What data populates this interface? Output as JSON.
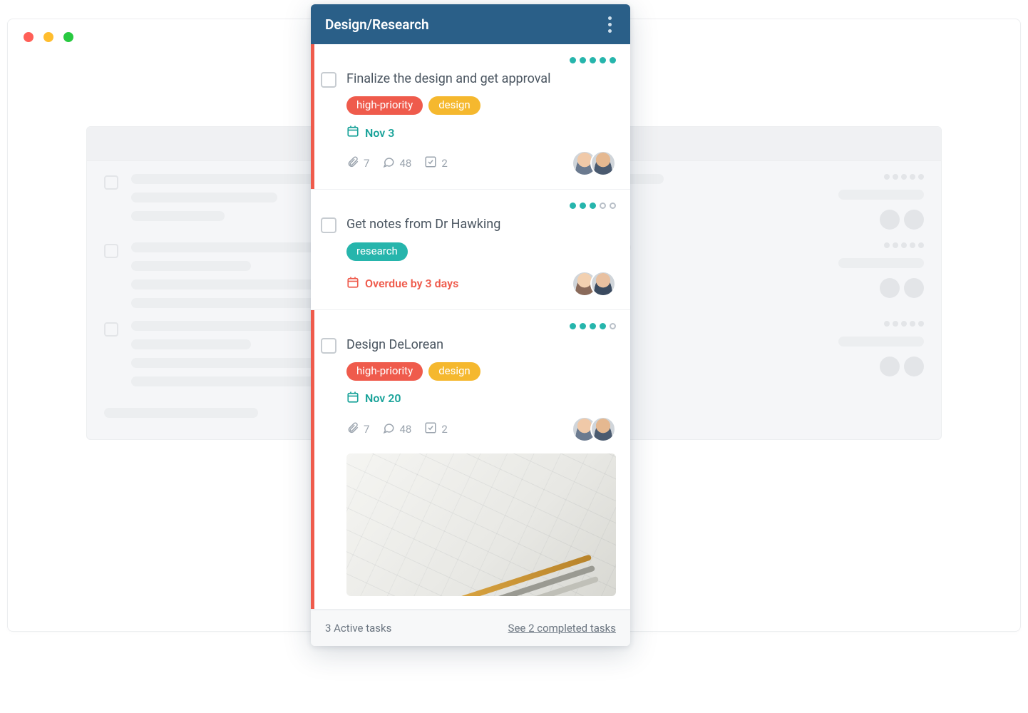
{
  "panel": {
    "title": "Design/Research"
  },
  "tasks": [
    {
      "title": "Finalize the design and get approval",
      "priority_stripe": true,
      "progress_filled": 5,
      "progress_total": 5,
      "tags": [
        {
          "label": "high-priority",
          "color": "red"
        },
        {
          "label": "design",
          "color": "yellow"
        }
      ],
      "date": {
        "label": "Nov 3",
        "status": "teal"
      },
      "stats": {
        "attachments": "7",
        "comments": "48",
        "subtasks": "2"
      },
      "assignees": 2,
      "has_preview": false
    },
    {
      "title": "Get notes from Dr Hawking",
      "priority_stripe": false,
      "progress_filled": 3,
      "progress_total": 5,
      "tags": [
        {
          "label": "research",
          "color": "teal"
        }
      ],
      "date": {
        "label": "Overdue by 3 days",
        "status": "red"
      },
      "stats": null,
      "assignees": 2,
      "has_preview": false
    },
    {
      "title": "Design DeLorean",
      "priority_stripe": true,
      "progress_filled": 4,
      "progress_total": 5,
      "tags": [
        {
          "label": "high-priority",
          "color": "red"
        },
        {
          "label": "design",
          "color": "yellow"
        }
      ],
      "date": {
        "label": "Nov 20",
        "status": "teal"
      },
      "stats": {
        "attachments": "7",
        "comments": "48",
        "subtasks": "2"
      },
      "assignees": 2,
      "has_preview": true
    }
  ],
  "footer": {
    "active_text": "3 Active tasks",
    "completed_link": "See 2 completed tasks"
  }
}
